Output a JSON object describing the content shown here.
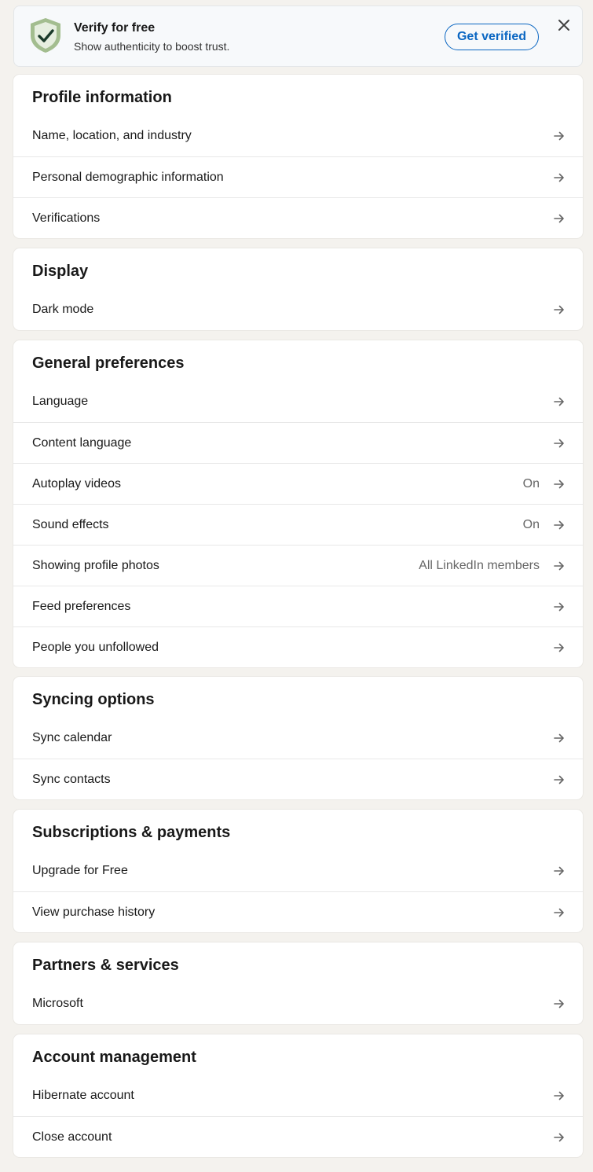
{
  "banner": {
    "title": "Verify for free",
    "subtitle": "Show authenticity to boost trust.",
    "cta_label": "Get verified",
    "icons": {
      "shield": "shield-check-icon",
      "close": "close-icon"
    },
    "colors": {
      "accent": "#0a66c2",
      "shield_fill": "#a3bd8f"
    }
  },
  "sections": [
    {
      "title": "Profile information",
      "items": [
        {
          "label": "Name, location, and industry",
          "value": ""
        },
        {
          "label": "Personal demographic information",
          "value": ""
        },
        {
          "label": "Verifications",
          "value": ""
        }
      ]
    },
    {
      "title": "Display",
      "items": [
        {
          "label": "Dark mode",
          "value": ""
        }
      ]
    },
    {
      "title": "General preferences",
      "items": [
        {
          "label": "Language",
          "value": ""
        },
        {
          "label": "Content language",
          "value": ""
        },
        {
          "label": "Autoplay videos",
          "value": "On"
        },
        {
          "label": "Sound effects",
          "value": "On"
        },
        {
          "label": "Showing profile photos",
          "value": "All LinkedIn members"
        },
        {
          "label": "Feed preferences",
          "value": ""
        },
        {
          "label": "People you unfollowed",
          "value": ""
        }
      ]
    },
    {
      "title": "Syncing options",
      "items": [
        {
          "label": "Sync calendar",
          "value": ""
        },
        {
          "label": "Sync contacts",
          "value": ""
        }
      ]
    },
    {
      "title": "Subscriptions & payments",
      "items": [
        {
          "label": "Upgrade for Free",
          "value": ""
        },
        {
          "label": "View purchase history",
          "value": ""
        }
      ]
    },
    {
      "title": "Partners & services",
      "items": [
        {
          "label": "Microsoft",
          "value": ""
        }
      ]
    },
    {
      "title": "Account management",
      "items": [
        {
          "label": "Hibernate account",
          "value": ""
        },
        {
          "label": "Close account",
          "value": ""
        }
      ]
    }
  ]
}
